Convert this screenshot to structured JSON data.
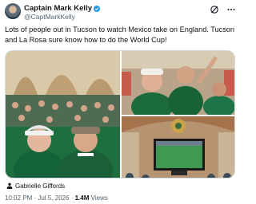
{
  "author": {
    "name": "Captain Mark Kelly",
    "handle": "@CaptMarkKelly",
    "verified_color": "#1d9bf0"
  },
  "tweet": {
    "lines": [
      "Lots of people out in Tucson to watch Mexico take on England. Tucson",
      "and La Rosa sure know how to do the World Cup!"
    ]
  },
  "media": {
    "tagged_user": "Gabrielle Giffords"
  },
  "meta": {
    "time": "10:02 PM",
    "separator": " · ",
    "date": "Jul 5, 2026",
    "views_count": "1.4M",
    "views_label": " Views"
  },
  "icons": {
    "grok": "grok-icon",
    "more": "more-icon",
    "verified": "verified-badge-icon",
    "person": "person-icon"
  },
  "colors": {
    "text": "#0f1419",
    "secondary": "#536471",
    "accent": "#1d9bf0",
    "border": "#cfd9de"
  }
}
